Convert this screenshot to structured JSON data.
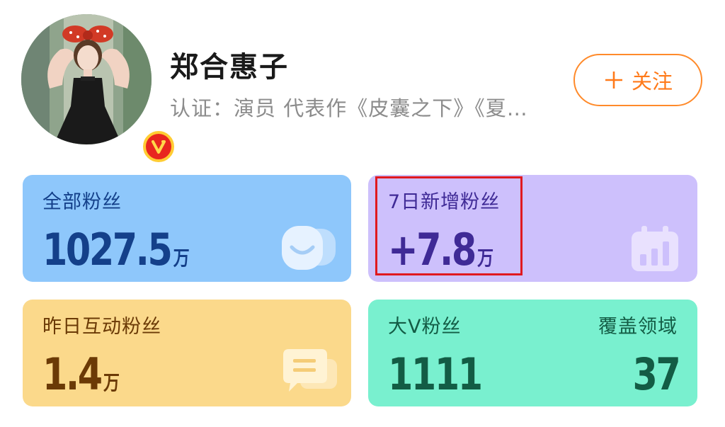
{
  "profile": {
    "name": "郑合惠子",
    "certification": "认证：演员 代表作《皮囊之下》《夏…",
    "follow_label": "关注",
    "follow_icon": "plus-icon",
    "avatar_icon": "avatar-photo",
    "verified_icon": "verified-v-badge"
  },
  "stats": {
    "all_fans": {
      "label": "全部粉丝",
      "value": "1027.5",
      "unit": "万",
      "icon": "smiley-chat-icon"
    },
    "new_fans_7d": {
      "label": "7日新增粉丝",
      "value": "+7.8",
      "unit": "万",
      "icon": "calendar-chart-icon"
    },
    "yesterday_interactive": {
      "label": "昨日互动粉丝",
      "value": "1.4",
      "unit": "万",
      "icon": "message-bubble-icon"
    },
    "big_v": {
      "label": "大V粉丝",
      "value": "1111",
      "coverage_label": "覆盖领域",
      "coverage_value": "37"
    }
  },
  "colors": {
    "accent_orange": "#ff7a1a",
    "highlight_red": "#e0191f",
    "card_blue": "#8ec7fb",
    "card_purple": "#cdc0fc",
    "card_yellow": "#fbd98b",
    "card_green": "#79f0cf"
  }
}
